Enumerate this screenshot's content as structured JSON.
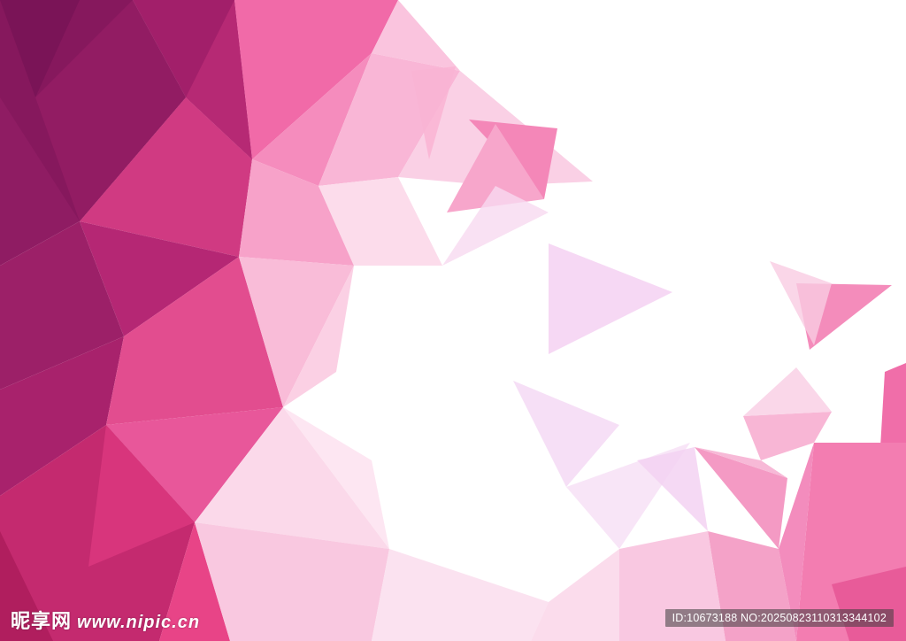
{
  "artwork": {
    "subject": "low-poly-triangle-background",
    "palette": {
      "deep_magenta": "#8e1a62",
      "magenta": "#c2286f",
      "hot_pink": "#ec3f86",
      "pink": "#f46aa6",
      "light_pink": "#f8a6cc",
      "pale_pink": "#fbd3e7",
      "lavender_pink": "#f6d9f5",
      "white": "#ffffff"
    }
  },
  "watermark": {
    "brand": "昵享网",
    "url": "www.nipic.cn"
  },
  "image_id": {
    "text": "ID:10673188 NO:20250823110313344102"
  }
}
